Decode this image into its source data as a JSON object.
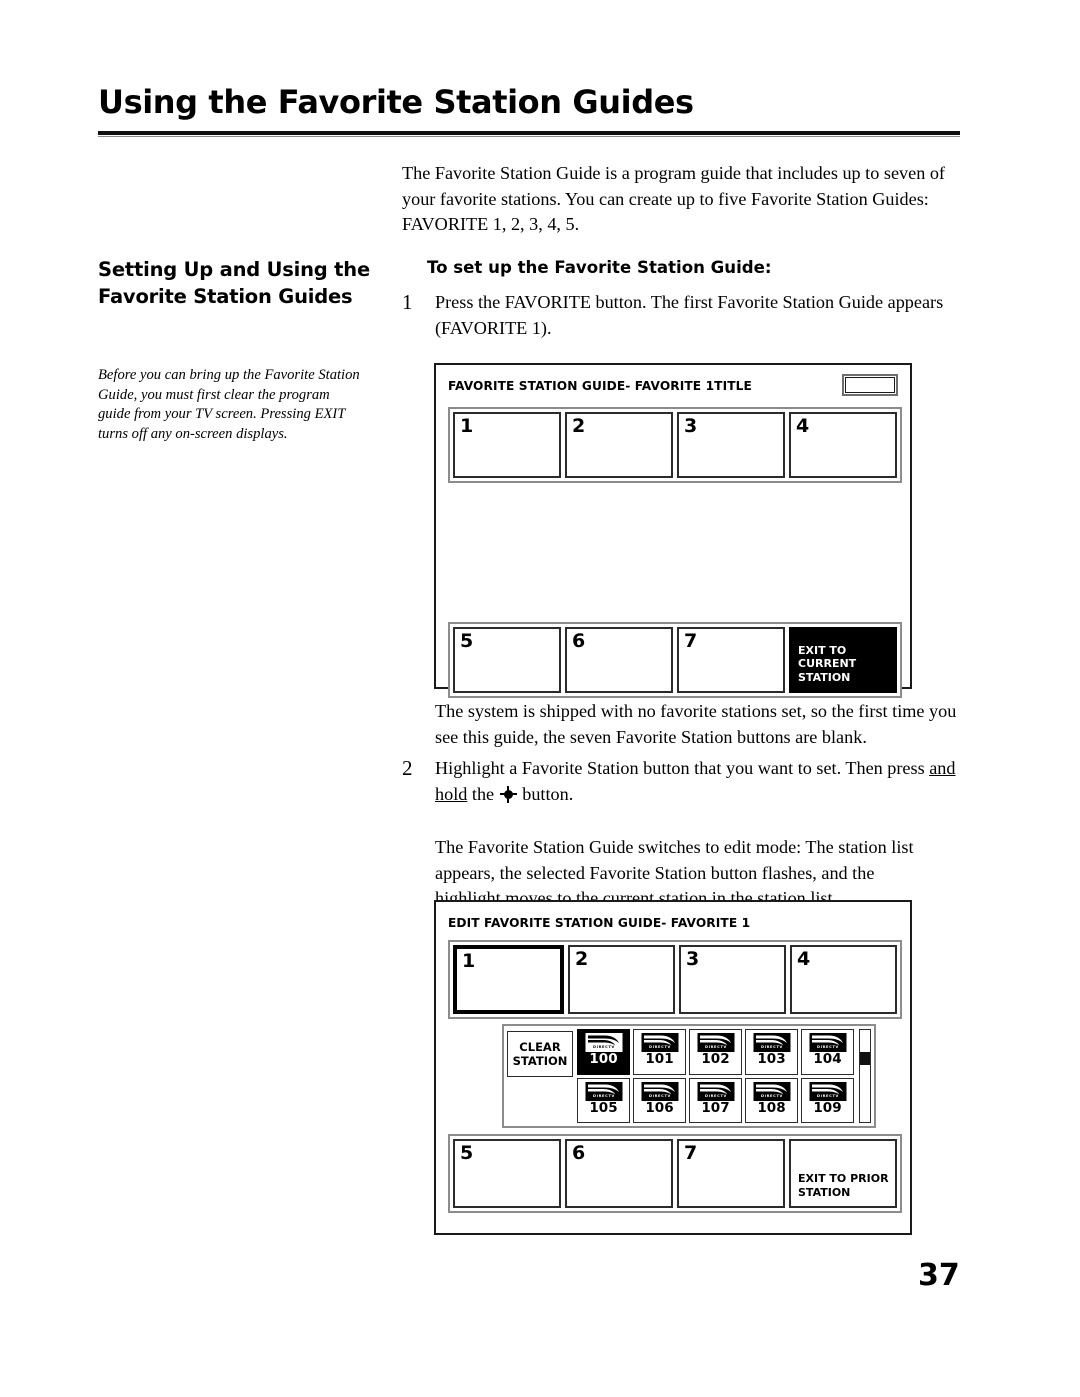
{
  "page": {
    "title": "Using the Favorite Station Guides",
    "number": "37"
  },
  "sidebar": {
    "heading": "Setting Up and Using the Favorite Station Guides",
    "note": "Before you can bring up the Favorite Station Guide, you must first clear the program guide from your TV screen. Pressing EXIT turns off any on-screen displays."
  },
  "main": {
    "intro": "The Favorite Station Guide is a program guide that includes up to seven of your favorite stations. You can create up to five Favorite Station Guides: FAVORITE 1, 2, 3, 4, 5.",
    "sub_heading": "To set up the Favorite Station Guide:",
    "step1": {
      "number": "1",
      "text": "Press the FAVORITE button. The first Favorite Station Guide appears (FAVORITE 1)."
    },
    "para_shipped": "The system is shipped with no favorite stations set, so the first time you see this guide, the seven Favorite Station buttons are blank.",
    "step2": {
      "number": "2",
      "text_before": "Highlight a Favorite Station button that you want to set. Then press ",
      "underlined": "and hold",
      "text_mid": " the ",
      "glyph": "select-button-icon",
      "text_after": " button."
    },
    "para_editmode": "The Favorite Station Guide switches to edit mode: The station list appears, the selected Favorite Station button flashes, and the highlight moves to the current station in the station list."
  },
  "guide_screen": {
    "header": "FAVORITE STATION GUIDE- FAVORITE 1TITLE",
    "title_slot_value": "",
    "top_buttons": [
      "1",
      "2",
      "3",
      "4"
    ],
    "bottom_buttons": [
      "5",
      "6",
      "7"
    ],
    "exit_button": {
      "label": "EXIT TO CURRENT STATION",
      "style": "inverted",
      "background": "#000000",
      "color": "#ffffff"
    }
  },
  "edit_screen": {
    "header": "EDIT FAVORITE STATION GUIDE- FAVORITE 1",
    "top_buttons": [
      {
        "label": "1",
        "selected": true
      },
      {
        "label": "2",
        "selected": false
      },
      {
        "label": "3",
        "selected": false
      },
      {
        "label": "4",
        "selected": false
      }
    ],
    "bottom_buttons": [
      "5",
      "6",
      "7"
    ],
    "exit_button": {
      "label": "EXIT TO PRIOR STATION",
      "style": "normal",
      "background": "#ffffff",
      "color": "#000000"
    },
    "station_list": {
      "clear_button": {
        "line1": "CLEAR",
        "line2": "STATION"
      },
      "brand": "DIRECTV",
      "stations": [
        {
          "number": "100",
          "highlighted": true
        },
        {
          "number": "101",
          "highlighted": false
        },
        {
          "number": "102",
          "highlighted": false
        },
        {
          "number": "103",
          "highlighted": false
        },
        {
          "number": "104",
          "highlighted": false
        },
        {
          "number": "105",
          "highlighted": false
        },
        {
          "number": "106",
          "highlighted": false
        },
        {
          "number": "107",
          "highlighted": false
        },
        {
          "number": "108",
          "highlighted": false
        },
        {
          "number": "109",
          "highlighted": false
        }
      ],
      "scrollbar": {
        "thumb_position_pct": 24,
        "thumb_size_pct": 14
      }
    }
  }
}
